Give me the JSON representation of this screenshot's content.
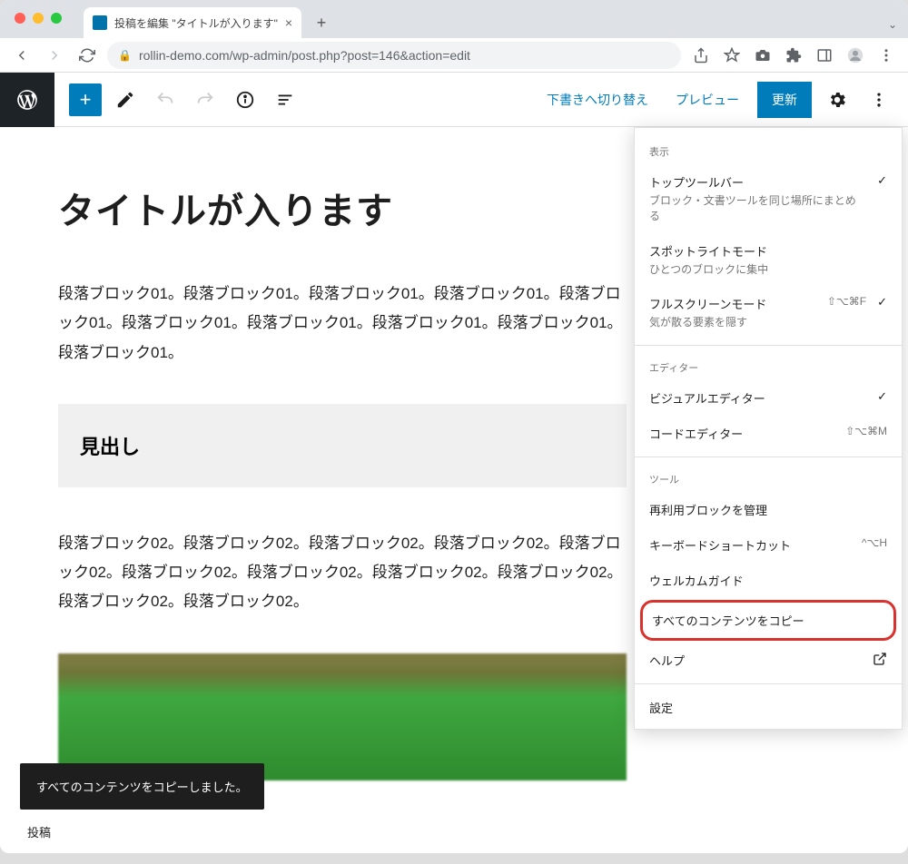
{
  "browser": {
    "tab_title": "投稿を編集 \"タイトルが入ります\"",
    "url": "rollin-demo.com/wp-admin/post.php?post=146&action=edit"
  },
  "toolbar": {
    "draft_switch": "下書きへ切り替え",
    "preview": "プレビュー",
    "update": "更新"
  },
  "post": {
    "title": "タイトルが入ります",
    "para1": "段落ブロック01。段落ブロック01。段落ブロック01。段落ブロック01。段落ブロック01。段落ブロック01。段落ブロック01。段落ブロック01。段落ブロック01。段落ブロック01。",
    "heading": "見出し",
    "para2": "段落ブロック02。段落ブロック02。段落ブロック02。段落ブロック02。段落ブロック02。段落ブロック02。段落ブロック02。段落ブロック02。段落ブロック02。段落ブロック02。段落ブロック02。"
  },
  "menu": {
    "section_view": "表示",
    "top_toolbar": {
      "title": "トップツールバー",
      "desc": "ブロック・文書ツールを同じ場所にまとめる"
    },
    "spotlight": {
      "title": "スポットライトモード",
      "desc": "ひとつのブロックに集中"
    },
    "fullscreen": {
      "title": "フルスクリーンモード",
      "desc": "気が散る要素を隠す",
      "shortcut": "⇧⌥⌘F"
    },
    "section_editor": "エディター",
    "visual": {
      "title": "ビジュアルエディター"
    },
    "code": {
      "title": "コードエディター",
      "shortcut": "⇧⌥⌘M"
    },
    "section_tools": "ツール",
    "reusable": "再利用ブロックを管理",
    "shortcuts": {
      "title": "キーボードショートカット",
      "shortcut": "^⌥H"
    },
    "welcome": "ウェルカムガイド",
    "copy_all": "すべてのコンテンツをコピー",
    "help": "ヘルプ",
    "preferences": "設定"
  },
  "snackbar": "すべてのコンテンツをコピーしました。",
  "footer": "投稿"
}
